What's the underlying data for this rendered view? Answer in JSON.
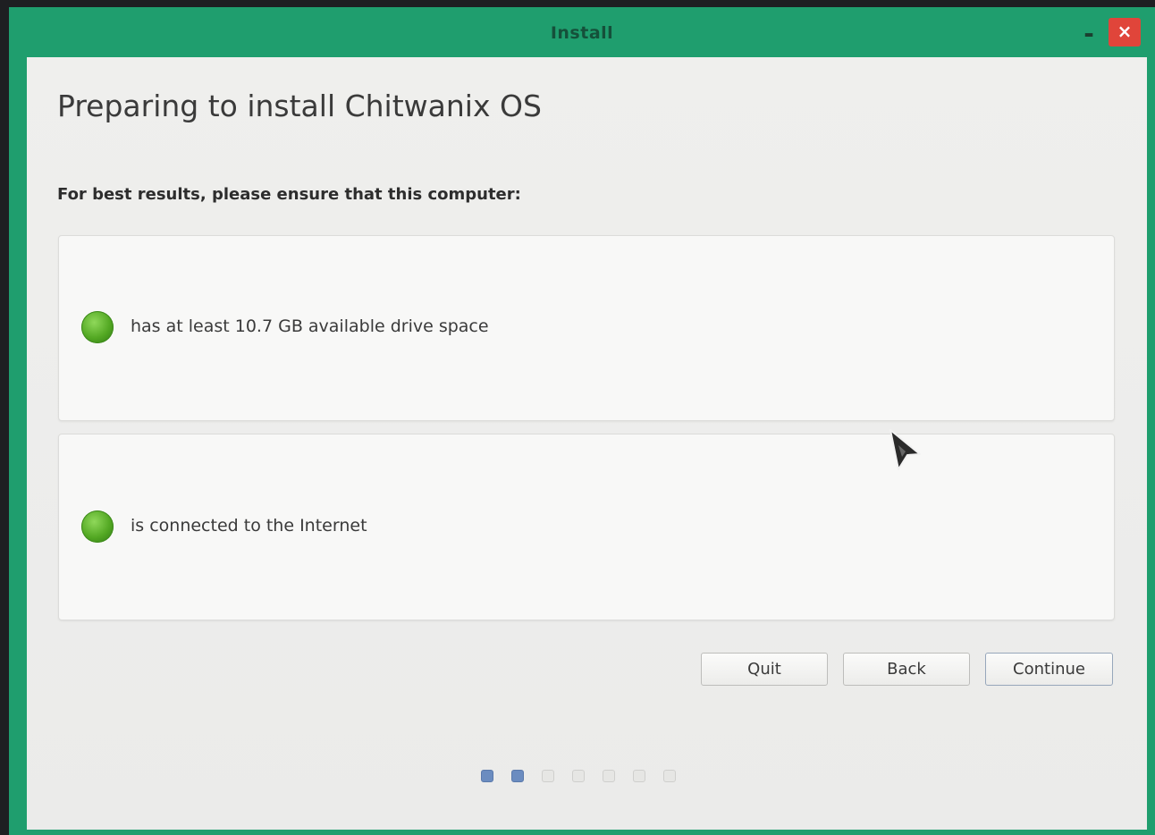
{
  "window": {
    "title": "Install"
  },
  "page": {
    "heading": "Preparing to install Chitwanix OS",
    "subheading": "For best results, please ensure that this computer:",
    "requirements": [
      {
        "label": "has at least 10.7 GB available drive space",
        "status_color": "#53a823"
      },
      {
        "label": "is connected to the Internet",
        "status_color": "#53a823"
      }
    ]
  },
  "buttons": {
    "quit": "Quit",
    "back": "Back",
    "continue": "Continue"
  },
  "progress": {
    "current_step": 2,
    "total_steps": 7
  },
  "titlebar_controls": {
    "minimize": "-",
    "close": "×"
  },
  "colors": {
    "frame": "#1f9e6e",
    "close": "#e0453a",
    "status_ok": "#53a823",
    "progress_active": "#6b8cc0"
  }
}
